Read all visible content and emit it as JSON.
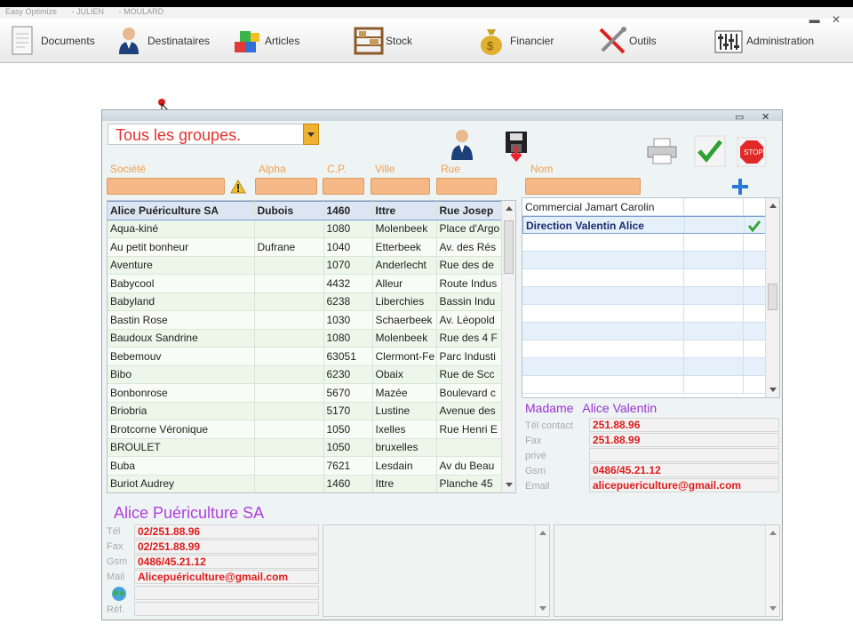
{
  "app": {
    "title_parts": [
      "Easy Optimize",
      "- JULIEN",
      "- MOULARD"
    ],
    "menu": [
      {
        "label": "Documents",
        "icon": "document-icon"
      },
      {
        "label": "Destinataires",
        "icon": "person-icon"
      },
      {
        "label": "Articles",
        "icon": "boxes-icon"
      },
      {
        "label": "Stock",
        "icon": "shelf-icon"
      },
      {
        "label": "Financier",
        "icon": "money-bag-icon"
      },
      {
        "label": "Outils",
        "icon": "tools-icon"
      },
      {
        "label": "Administration",
        "icon": "sliders-icon"
      }
    ]
  },
  "window": {
    "group_select": "Tous les groupes.",
    "filters": {
      "societe": "Société",
      "alpha": "Alpha",
      "cp": "C.P.",
      "ville": "Ville",
      "rue": "Rue",
      "nom": "Nom"
    },
    "companies": [
      {
        "societe": "Alice Puériculture SA",
        "alpha": "Dubois",
        "cp": "1460",
        "ville": "Ittre",
        "rue": "Rue Josep"
      },
      {
        "societe": "Aqua-kiné",
        "alpha": "",
        "cp": "1080",
        "ville": "Molenbeek",
        "rue": "Place d'Argo"
      },
      {
        "societe": "Au petit bonheur",
        "alpha": "Dufrane",
        "cp": "1040",
        "ville": "Etterbeek",
        "rue": "Av. des Rés"
      },
      {
        "societe": "Aventure",
        "alpha": "",
        "cp": "1070",
        "ville": "Anderlecht",
        "rue": "Rue des de"
      },
      {
        "societe": "Babycool",
        "alpha": "",
        "cp": "4432",
        "ville": "Alleur",
        "rue": "Route Indus"
      },
      {
        "societe": "Babyland",
        "alpha": "",
        "cp": "6238",
        "ville": "Liberchies",
        "rue": "Bassin Indu"
      },
      {
        "societe": "Bastin Rose",
        "alpha": "",
        "cp": "1030",
        "ville": "Schaerbeek",
        "rue": "Av. Léopold"
      },
      {
        "societe": "Baudoux Sandrine",
        "alpha": "",
        "cp": "1080",
        "ville": "Molenbeek",
        "rue": "Rue des 4 F"
      },
      {
        "societe": "Bebemouv",
        "alpha": "",
        "cp": "63051",
        "ville": "Clermont-Fe",
        "rue": "Parc Industi"
      },
      {
        "societe": "Bibo",
        "alpha": "",
        "cp": "6230",
        "ville": "Obaix",
        "rue": "Rue de Scc"
      },
      {
        "societe": "Bonbonrose",
        "alpha": "",
        "cp": "5670",
        "ville": "Mazée",
        "rue": "Boulevard c"
      },
      {
        "societe": "Briobria",
        "alpha": "",
        "cp": "5170",
        "ville": "Lustine",
        "rue": "Avenue des"
      },
      {
        "societe": "Brotcorne Véronique",
        "alpha": "",
        "cp": "1050",
        "ville": "Ixelles",
        "rue": "Rue Henri E"
      },
      {
        "societe": "BROULET",
        "alpha": "",
        "cp": "1050",
        "ville": "bruxelles",
        "rue": ""
      },
      {
        "societe": "Buba",
        "alpha": "",
        "cp": "7621",
        "ville": "Lesdain",
        "rue": "Av du Beau"
      },
      {
        "societe": "Buriot Audrey",
        "alpha": "",
        "cp": "1460",
        "ville": "Ittre",
        "rue": "Planche 45"
      }
    ],
    "contacts": [
      {
        "name": "Commercial Jamart Carolin",
        "selected": false
      },
      {
        "name": "Direction Valentin Alice",
        "selected": true
      }
    ],
    "contact_detail": {
      "civility": "Madame",
      "name": "Alice Valentin",
      "labels": {
        "tel": "Tél contact",
        "fax": "Fax",
        "prive": "privé",
        "gsm": "Gsm",
        "email": "Email"
      },
      "tel": "251.88.96",
      "fax": "251.88.99",
      "prive": "",
      "gsm": "0486/45.21.12",
      "email": "alicepuericulture@gmail.com"
    },
    "company_detail": {
      "name": "Alice Puériculture SA",
      "labels": {
        "tel": "Tél",
        "fax": "Fax",
        "gsm": "Gsm",
        "mail": "Mail",
        "ref": "Réf."
      },
      "tel": "02/251.88.96",
      "fax": "02/251.88.99",
      "gsm": "0486/45.21.12",
      "mail": "Alicepuériculture@gmail.com",
      "web": "",
      "ref": ""
    }
  },
  "colors": {
    "accent_orange": "#f5b886",
    "red_text": "#e01b1b",
    "purple_text": "#b040e0"
  }
}
